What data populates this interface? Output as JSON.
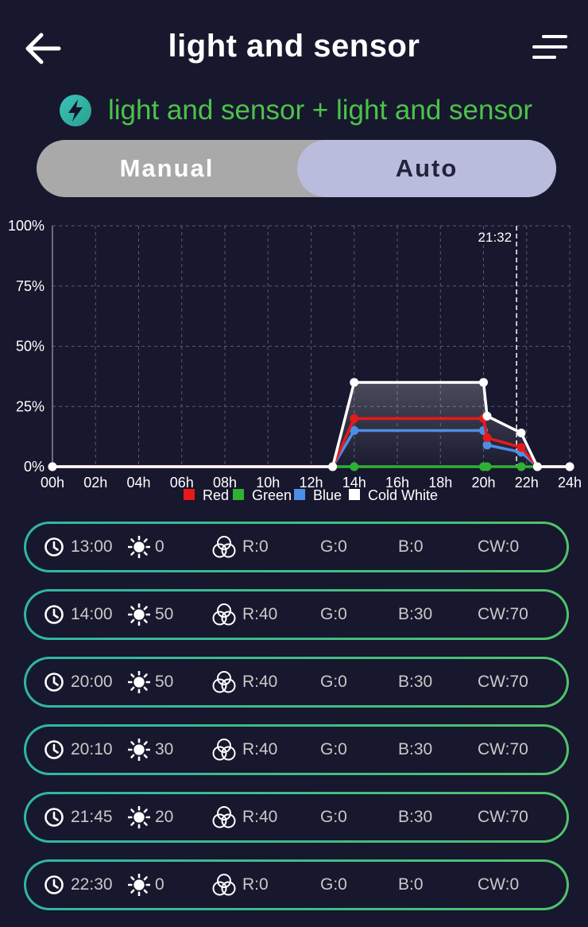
{
  "header": {
    "title": "light and sensor",
    "back_icon": "arrow-left-icon",
    "menu_icon": "menu-icon"
  },
  "device": {
    "label": "light and sensor + light and sensor",
    "icon": "lightning-bolt-icon",
    "accent": "#4cc24a"
  },
  "mode": {
    "manual_label": "Manual",
    "auto_label": "Auto",
    "selected": "Auto"
  },
  "chart_data": {
    "type": "line",
    "x_ticks": [
      "00h",
      "02h",
      "04h",
      "06h",
      "08h",
      "10h",
      "12h",
      "14h",
      "16h",
      "18h",
      "20h",
      "22h",
      "24h"
    ],
    "y_ticks": [
      "100%",
      "75%",
      "50%",
      "25%",
      "0%"
    ],
    "ylim": [
      0,
      100
    ],
    "xlim": [
      0,
      24
    ],
    "grid": true,
    "current_time": "21:32",
    "current_time_hours": 21.533,
    "legend_position": "bottom",
    "x": [
      0,
      13,
      14,
      20,
      20.167,
      21.75,
      22.5,
      24
    ],
    "series": [
      {
        "name": "Red",
        "color": "#e61a1a",
        "values": [
          0,
          0,
          20,
          20,
          12,
          8,
          0,
          0
        ]
      },
      {
        "name": "Green",
        "color": "#2fb133",
        "values": [
          0,
          0,
          0,
          0,
          0,
          0,
          0,
          0
        ]
      },
      {
        "name": "Blue",
        "color": "#4b8fe6",
        "values": [
          0,
          0,
          15,
          15,
          9,
          6,
          0,
          0
        ]
      },
      {
        "name": "Cold White",
        "color": "#ffffff",
        "values": [
          0,
          0,
          35,
          35,
          21,
          14,
          0,
          0
        ]
      }
    ]
  },
  "schedule": [
    {
      "time": "13:00",
      "brightness": "0",
      "r": "R:0",
      "g": "G:0",
      "b": "B:0",
      "cw": "CW:0"
    },
    {
      "time": "14:00",
      "brightness": "50",
      "r": "R:40",
      "g": "G:0",
      "b": "B:30",
      "cw": "CW:70"
    },
    {
      "time": "20:00",
      "brightness": "50",
      "r": "R:40",
      "g": "G:0",
      "b": "B:30",
      "cw": "CW:70"
    },
    {
      "time": "20:10",
      "brightness": "30",
      "r": "R:40",
      "g": "G:0",
      "b": "B:30",
      "cw": "CW:70"
    },
    {
      "time": "21:45",
      "brightness": "20",
      "r": "R:40",
      "g": "G:0",
      "b": "B:30",
      "cw": "CW:70"
    },
    {
      "time": "22:30",
      "brightness": "0",
      "r": "R:0",
      "g": "G:0",
      "b": "B:0",
      "cw": "CW:0"
    }
  ]
}
